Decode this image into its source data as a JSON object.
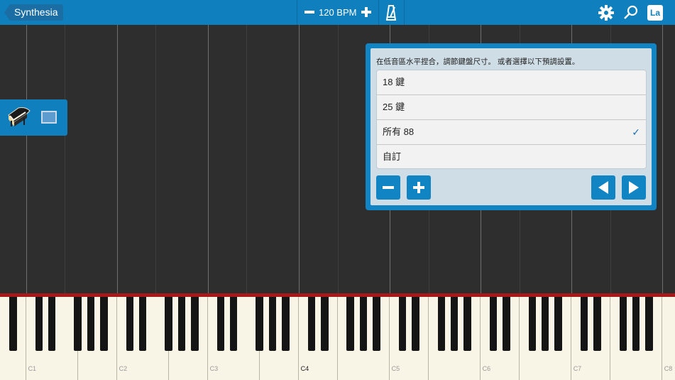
{
  "app": {
    "back_label": "Synthesia"
  },
  "toolbar": {
    "bpm_label": "120 BPM",
    "label_button": "La"
  },
  "dialog": {
    "message": "在低音區水平捏合，調節鍵盤尺寸。 或者選擇以下預調設置。",
    "options": [
      {
        "label": "18 鍵",
        "selected": false
      },
      {
        "label": "25 鍵",
        "selected": false
      },
      {
        "label": "所有 88",
        "selected": true
      },
      {
        "label": "自訂",
        "selected": false
      }
    ],
    "check_glyph": "✓"
  },
  "keyboard": {
    "octave_labels": [
      "C1",
      "C2",
      "C3",
      "C4",
      "C5",
      "C6",
      "C7",
      "C8"
    ],
    "highlight_label": "C4"
  },
  "colors": {
    "accent": "#0f7fbd",
    "background": "#2e2e2e",
    "keyboard_trim": "#8a0e0e"
  }
}
